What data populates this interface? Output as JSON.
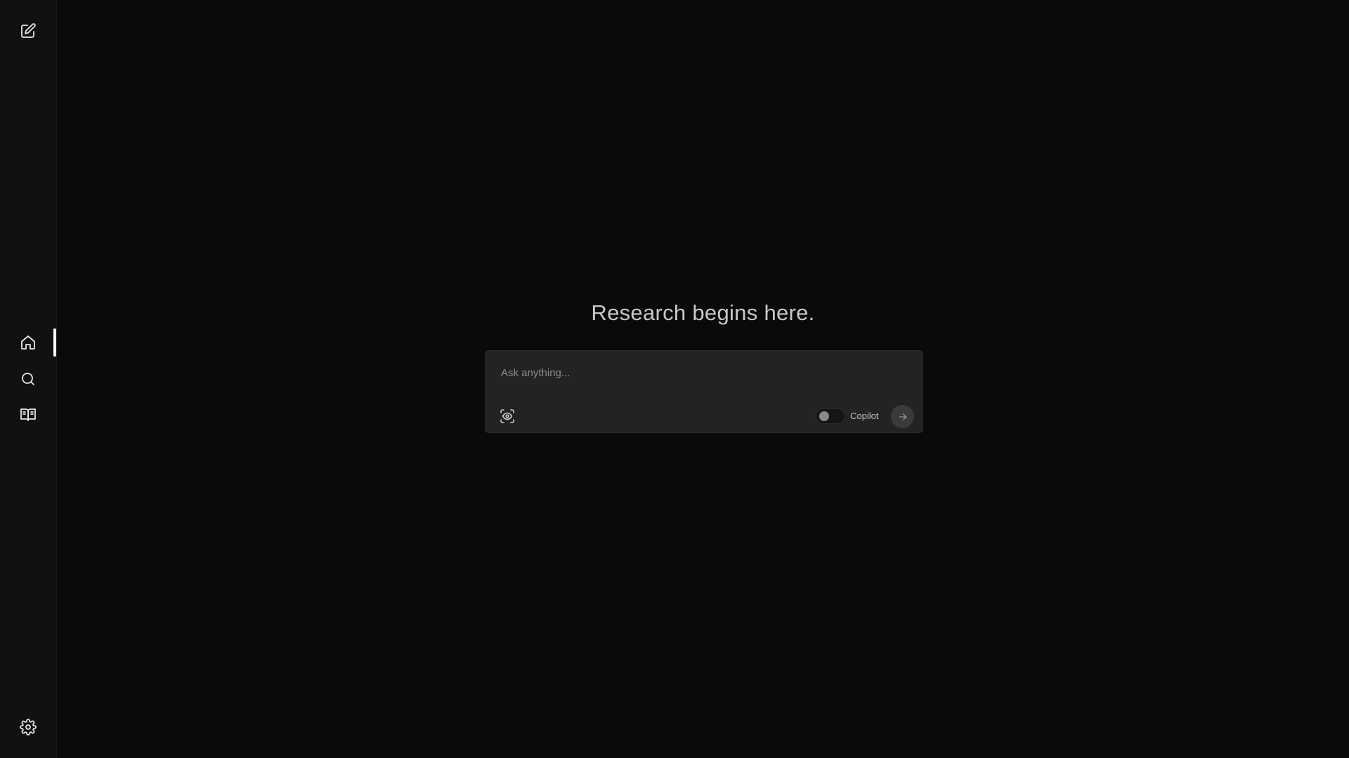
{
  "sidebar": {
    "new_thread_icon": "edit-icon",
    "nav_items": [
      {
        "id": "home",
        "icon": "home-icon",
        "active": true
      },
      {
        "id": "discover",
        "icon": "search-icon",
        "active": false
      },
      {
        "id": "library",
        "icon": "book-icon",
        "active": false
      }
    ],
    "settings_icon": "gear-icon"
  },
  "main": {
    "title": "Research begins here.",
    "composer": {
      "placeholder": "Ask anything...",
      "value": "",
      "focus_icon": "scan-eye-icon",
      "copilot_label": "Copilot",
      "copilot_enabled": false,
      "submit_icon": "arrow-right-icon"
    }
  },
  "colors": {
    "background": "#0a0a0a",
    "sidebar": "#111111",
    "composer": "#232323",
    "active_indicator": "#ffffff"
  }
}
